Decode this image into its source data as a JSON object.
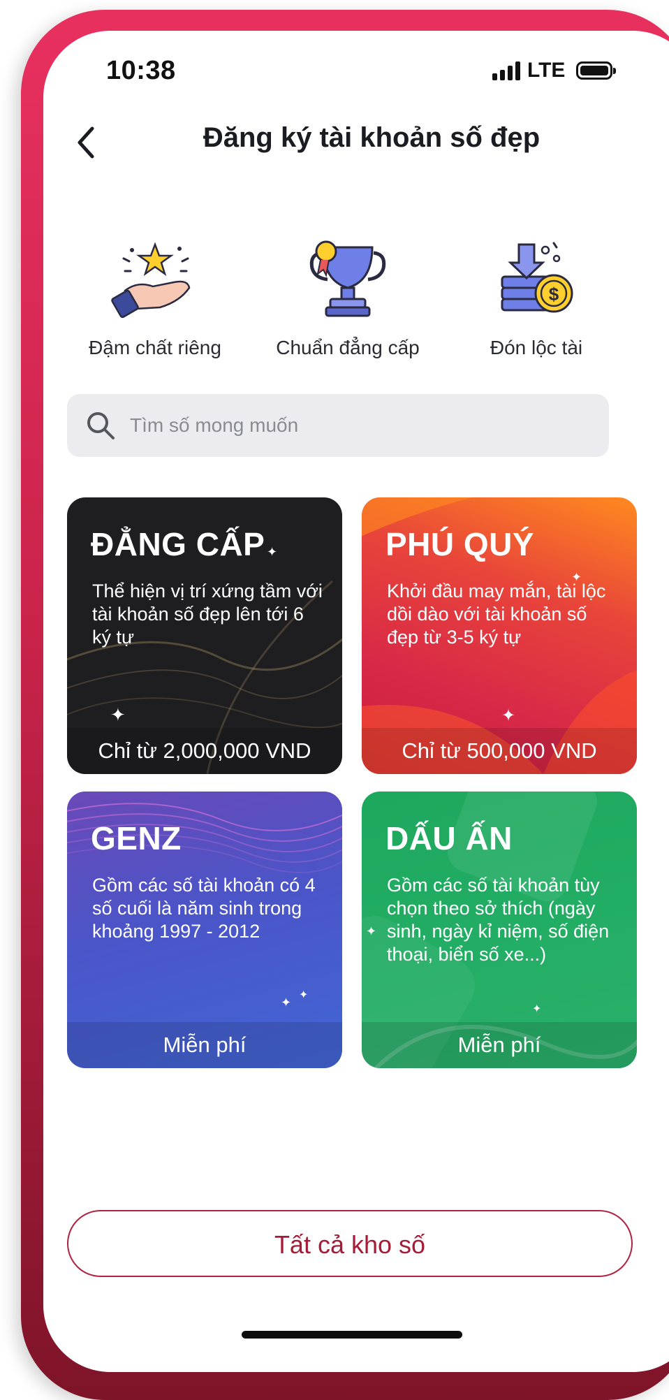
{
  "status_bar": {
    "time": "10:38",
    "network": "LTE"
  },
  "header": {
    "title": "Đăng ký tài khoản số đẹp"
  },
  "features": [
    {
      "label": "Đậm chất riêng",
      "icon": "hand-star-icon"
    },
    {
      "label": "Chuẩn đẳng cấp",
      "icon": "trophy-icon"
    },
    {
      "label": "Đón lộc tài",
      "icon": "coin-stack-icon"
    }
  ],
  "search": {
    "placeholder": "Tìm số mong muốn"
  },
  "cards": [
    {
      "title": "ĐẲNG CẤP",
      "description": "Thể hiện vị trí xứng tầm với tài khoản số đẹp lên tới 6 ký tự",
      "price": "Chỉ từ 2,000,000 VND",
      "color": "#1e1e20"
    },
    {
      "title": "PHÚ QUÝ",
      "description": "Khởi đầu may mắn, tài lộc dồi dào với tài khoản số đẹp từ 3-5 ký tự",
      "price": "Chỉ từ 500,000 VND",
      "color": "#e0374a"
    },
    {
      "title": "GENZ",
      "description": "Gồm các số tài khoản có 4 số cuối  là năm sinh trong khoảng 1997 - 2012",
      "price": "Miễn phí",
      "color": "#4058c0"
    },
    {
      "title": "DẤU ẤN",
      "description": "Gồm các số tài khoản tùy chọn theo sở thích (ngày sinh, ngày kỉ niệm, số điện thoại, biển số xe...)",
      "price": "Miễn phí",
      "color": "#23a862"
    }
  ],
  "footer": {
    "all_button_label": "Tất cả kho số"
  },
  "colors": {
    "brand": "#c9234a",
    "button_text": "#a51c38"
  }
}
